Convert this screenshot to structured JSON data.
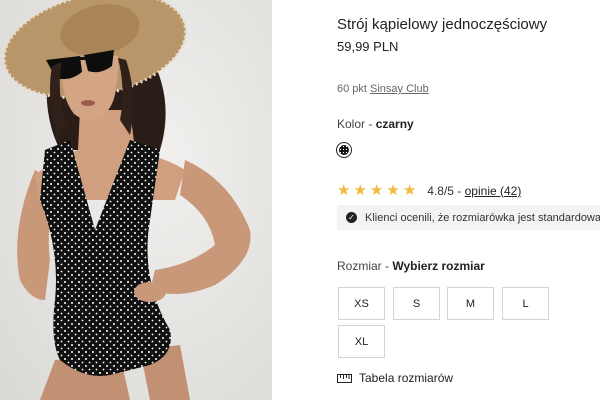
{
  "product": {
    "title": "Strój kąpielowy jednoczęściowy",
    "price": "59,99 PLN",
    "points": "60 pkt",
    "club_link": "Sinsay Club"
  },
  "color": {
    "label": "Kolor",
    "separator": " - ",
    "value": "czarny",
    "swatch_color": "#111111"
  },
  "rating": {
    "stars": 5,
    "text": "4.8/5 - ",
    "reviews_link": "opinie (42)",
    "star_color": "#f4b83a"
  },
  "fit_notice": {
    "icon": "check-circle-icon",
    "text": "Klienci ocenili, że rozmiarówka jest standardowa."
  },
  "size": {
    "label": "Rozmiar",
    "separator": " - ",
    "prompt": "Wybierz rozmiar",
    "options": [
      "XS",
      "S",
      "M",
      "L",
      "XL"
    ]
  },
  "size_table": {
    "icon": "ruler-icon",
    "label": "Tabela rozmiarów"
  },
  "image": {
    "subject": "model in polka-dot one-piece swimsuit with sun hat and sunglasses",
    "swimsuit_color": "#111111",
    "dot_color": "#ffffff"
  }
}
